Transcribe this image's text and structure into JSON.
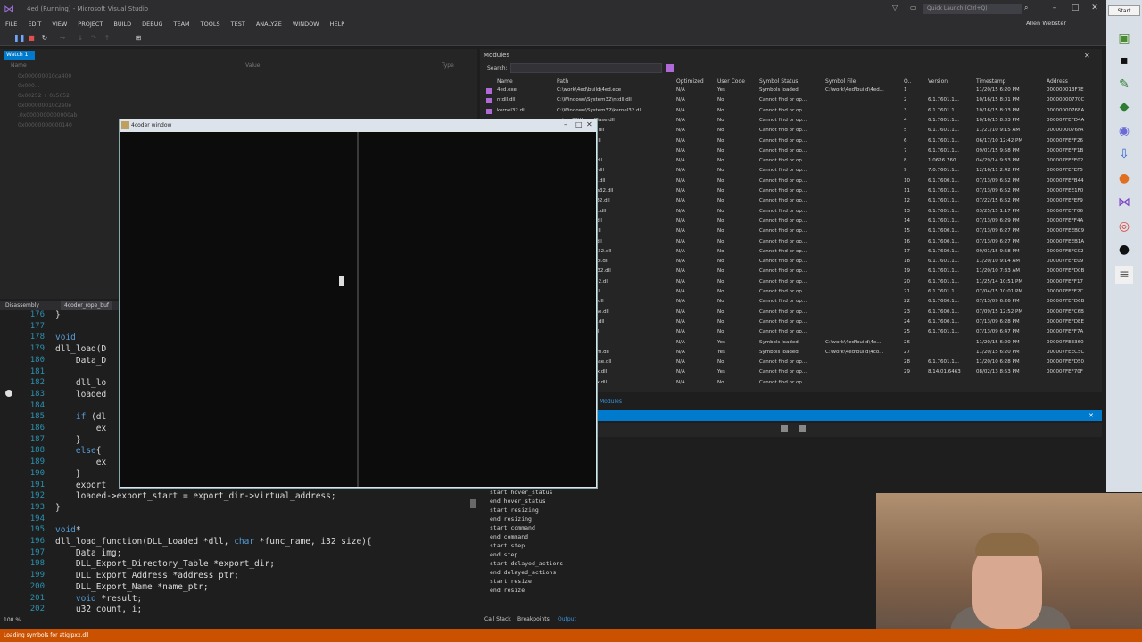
{
  "app": {
    "title": "4ed (Running) - Microsoft Visual Studio",
    "quick_launch": "Quick Launch (Ctrl+Q)",
    "user": "Allen Webster"
  },
  "menu": [
    "FILE",
    "EDIT",
    "VIEW",
    "PROJECT",
    "BUILD",
    "DEBUG",
    "TEAM",
    "TOOLS",
    "TEST",
    "ANALYZE",
    "WINDOW",
    "HELP"
  ],
  "watch": {
    "tab": "Watch 1",
    "headers": {
      "name": "Name",
      "value": "Value",
      "type": "Type"
    },
    "rows": [
      "0x000000010ca400",
      "0x000...",
      "0x00252 + 0x5652",
      "0x000000010c2e0e",
      ".0x0000000000000ab",
      "0x00000000000140"
    ]
  },
  "modules": {
    "title": "Modules",
    "search_label": "Search:",
    "headers": [
      "Name",
      "Path",
      "Optimized",
      "User Code",
      "Symbol Status",
      "Symbol File",
      "O..",
      "Version",
      "Timestamp",
      "Address"
    ],
    "rows": [
      [
        "4ed.exe",
        "C:\\work\\4ed\\build\\4ed.exe",
        "N/A",
        "Yes",
        "Symbols loaded.",
        "C:\\work\\4ed\\build\\4ed...",
        "1",
        "",
        "11/20/15 6:20 PM",
        "000000013F7E"
      ],
      [
        "ntdll.dll",
        "C:\\Windows\\System32\\ntdll.dll",
        "N/A",
        "No",
        "Cannot find or op...",
        "",
        "2",
        "6.1.7601.1...",
        "10/16/15 8:01 PM",
        "00000000770C"
      ],
      [
        "kernel32.dll",
        "C:\\Windows\\System32\\kernel32.dll",
        "N/A",
        "No",
        "Cannot find or op...",
        "",
        "3",
        "6.1.7601.1...",
        "10/16/15 8:03 PM",
        "0000000076EA"
      ],
      [
        "",
        "ystem32\\KernelBase.dll",
        "N/A",
        "No",
        "Cannot find or op...",
        "",
        "4",
        "6.1.7601.1...",
        "10/16/15 8:03 PM",
        "000007FEFD4A"
      ],
      [
        "",
        "ystem32\\user32.dll",
        "N/A",
        "No",
        "Cannot find or op...",
        "",
        "5",
        "6.1.7601.1...",
        "11/21/10 9:15 AM",
        "0000000076FA"
      ],
      [
        "",
        "ystem32\\gdi32.dll",
        "N/A",
        "No",
        "Cannot find or op...",
        "",
        "6",
        "6.1.7601.1...",
        "06/17/10 12:42 PM",
        "000007FEFF26"
      ],
      [
        "",
        "ystem32\\lpk.dll",
        "N/A",
        "No",
        "Cannot find or op...",
        "",
        "7",
        "6.1.7601.1...",
        "09/01/15 9:58 PM",
        "000007FEFF1B"
      ],
      [
        "",
        "ystem32\\usp10.dll",
        "N/A",
        "No",
        "Cannot find or op...",
        "",
        "8",
        "1.0626.760...",
        "04/29/14 9:33 PM",
        "000007FEFE02"
      ],
      [
        "",
        "ystem32\\msvcrt.dll",
        "N/A",
        "No",
        "Cannot find or op...",
        "",
        "9",
        "7.0.7601.1...",
        "12/16/11 2:42 PM",
        "000007FEFEF5"
      ],
      [
        "",
        "ystem32\\winmm.dll",
        "N/A",
        "No",
        "Cannot find or op...",
        "",
        "10",
        "6.1.7600.1...",
        "07/13/09 6:52 PM",
        "000007FEFB44"
      ],
      [
        "",
        "ystem32\\ntmarta32.dll",
        "N/A",
        "No",
        "Cannot find or op...",
        "",
        "11",
        "6.1.7601.1...",
        "07/13/09 6:52 PM",
        "000007FEE1F0"
      ],
      [
        "",
        "ystem32\\advapi32.dll",
        "N/A",
        "No",
        "Cannot find or op...",
        "",
        "12",
        "6.1.7601.1...",
        "07/22/15 6:52 PM",
        "000007FEFEF9"
      ],
      [
        "",
        "ystem32\\sechost.dll",
        "N/A",
        "No",
        "Cannot find or op...",
        "",
        "13",
        "6.1.7601.1...",
        "03/25/15 1:17 PM",
        "000007FEFF06"
      ],
      [
        "",
        "ystem32\\rpcrt4.dll",
        "N/A",
        "No",
        "Cannot find or op...",
        "",
        "14",
        "6.1.7601.1...",
        "07/13/09 6:29 PM",
        "000007FEFF4A"
      ],
      [
        "",
        "ystem32\\glu32.dll",
        "N/A",
        "No",
        "Cannot find or op...",
        "",
        "15",
        "6.1.7600.1...",
        "07/13/09 6:27 PM",
        "000007FEEBC9"
      ],
      [
        "",
        "ystem32\\ddraw.dll",
        "N/A",
        "No",
        "Cannot find or op...",
        "",
        "16",
        "6.1.7600.1...",
        "07/13/09 6:27 PM",
        "000007FEEB1A"
      ],
      [
        "",
        "ystem32\\dciman32.dll",
        "N/A",
        "No",
        "Cannot find or op...",
        "",
        "17",
        "6.1.7600.1...",
        "09/01/15 9:58 PM",
        "000007FEFC02"
      ],
      [
        "",
        "ystem32\\setupapi.dll",
        "N/A",
        "No",
        "Cannot find or op...",
        "",
        "18",
        "6.1.7601.1...",
        "11/20/10 9:14 AM",
        "000007FEFE09"
      ],
      [
        "",
        "ystem32\\cfgmgr32.dll",
        "N/A",
        "No",
        "Cannot find or op...",
        "",
        "19",
        "6.1.7601.1...",
        "11/20/10 7:33 AM",
        "000007FEFD0B"
      ],
      [
        "",
        "ystem32\\oleaut32.dll",
        "N/A",
        "No",
        "Cannot find or op...",
        "",
        "20",
        "6.1.7601.1...",
        "11/25/14 10:51 PM",
        "000007FEFF17"
      ],
      [
        "",
        "ystem32\\ole32.dll",
        "N/A",
        "No",
        "Cannot find or op...",
        "",
        "21",
        "6.1.7601.1...",
        "07/04/15 10:01 PM",
        "000007FEFF2C"
      ],
      [
        "",
        "ystem32\\devobj.dll",
        "N/A",
        "No",
        "Cannot find or op...",
        "",
        "22",
        "6.1.7600.1...",
        "07/13/09 6:26 PM",
        "000007FEFD6B"
      ],
      [
        "",
        "ystem32\\uxtheme.dll",
        "N/A",
        "No",
        "Cannot find or op...",
        "",
        "23",
        "6.1.7600.1...",
        "07/09/15 12:52 PM",
        "000007FEFC6B"
      ],
      [
        "",
        "ystem32\\imm32.dll",
        "N/A",
        "No",
        "Cannot find or op...",
        "",
        "24",
        "6.1.7600.1...",
        "07/13/09 6:28 PM",
        "000007FEFDEE"
      ],
      [
        "",
        "ystem32\\msctf.dll",
        "N/A",
        "No",
        "Cannot find or op...",
        "",
        "25",
        "6.1.7601.1...",
        "07/13/09 6:47 PM",
        "000007FEFF7A"
      ],
      [
        "",
        "ild\\4ed_app.dll",
        "N/A",
        "Yes",
        "Symbols loaded.",
        "C:\\work\\4ed\\build\\4e...",
        "26",
        "",
        "11/20/15 6:20 PM",
        "000007FEE360"
      ],
      [
        "",
        "ild\\4coder_custom.dll",
        "N/A",
        "Yes",
        "Symbols loaded.",
        "C:\\work\\4ed\\build\\4co...",
        "27",
        "",
        "11/20/15 6:20 PM",
        "000007FEEC5C"
      ],
      [
        "",
        "ystem32\\cryptbase.dll",
        "N/A",
        "No",
        "Cannot find or op...",
        "",
        "28",
        "6.1.7601.1...",
        "11/20/10 6:28 PM",
        "000007FEFD50"
      ],
      [
        "",
        "ystem32\\atiglpxx.dll",
        "N/A",
        "Yes",
        "Cannot find or op...",
        "",
        "29",
        "8.14.01.6463",
        "08/02/13 8:53 PM",
        "000007FEF70F"
      ],
      [
        "",
        "ystem32\\atioglxx.dll",
        "N/A",
        "No",
        "Cannot find or op...",
        "",
        "",
        "",
        "",
        ""
      ]
    ]
  },
  "editor": {
    "tabs": [
      "Disassembly",
      "4coder_rope_buf"
    ],
    "zoom": "100 %",
    "lines": [
      {
        "n": "176",
        "t": "}"
      },
      {
        "n": "177",
        "t": ""
      },
      {
        "n": "178",
        "t": "void"
      },
      {
        "n": "179",
        "t": "dll_load(D"
      },
      {
        "n": "180",
        "t": "    Data_D"
      },
      {
        "n": "181",
        "t": ""
      },
      {
        "n": "182",
        "t": "    dll_lo"
      },
      {
        "n": "183",
        "t": "    loaded"
      },
      {
        "n": "184",
        "t": ""
      },
      {
        "n": "185",
        "t": "    if (dl"
      },
      {
        "n": "186",
        "t": "        ex"
      },
      {
        "n": "187",
        "t": "    }"
      },
      {
        "n": "188",
        "t": "    else{"
      },
      {
        "n": "189",
        "t": "        ex"
      },
      {
        "n": "190",
        "t": "    }"
      },
      {
        "n": "191",
        "t": "    export"
      },
      {
        "n": "192",
        "t": "    loaded->export_start = export_dir->virtual_address;"
      },
      {
        "n": "193",
        "t": "}"
      },
      {
        "n": "194",
        "t": ""
      },
      {
        "n": "195",
        "t": "void*"
      },
      {
        "n": "196",
        "t": "dll_load_function(DLL_Loaded *dll, char *func_name, i32 size){"
      },
      {
        "n": "197",
        "t": "    Data img;"
      },
      {
        "n": "198",
        "t": "    DLL_Export_Directory_Table *export_dir;"
      },
      {
        "n": "199",
        "t": "    DLL_Export_Address *address_ptr;"
      },
      {
        "n": "200",
        "t": "    DLL_Export_Name *name_ptr;"
      },
      {
        "n": "201",
        "t": "    void *result;"
      },
      {
        "n": "202",
        "t": "    u32 count, i;"
      }
    ]
  },
  "coder_window": {
    "title": "4coder window"
  },
  "output": {
    "tab": "Modules",
    "lines": [
      "start hover_status",
      "end hover_status",
      "start resizing",
      "end resizing",
      "start command",
      "end command",
      "start step",
      "end step",
      "start delayed_actions",
      "end delayed_actions",
      "start resize",
      "end resize"
    ],
    "bottom_tabs": [
      "Call Stack",
      "Breakpoints",
      "Output"
    ]
  },
  "status": {
    "text": "Loading symbols for atiglpxx.dll"
  },
  "taskbar": {
    "start": "Start"
  }
}
